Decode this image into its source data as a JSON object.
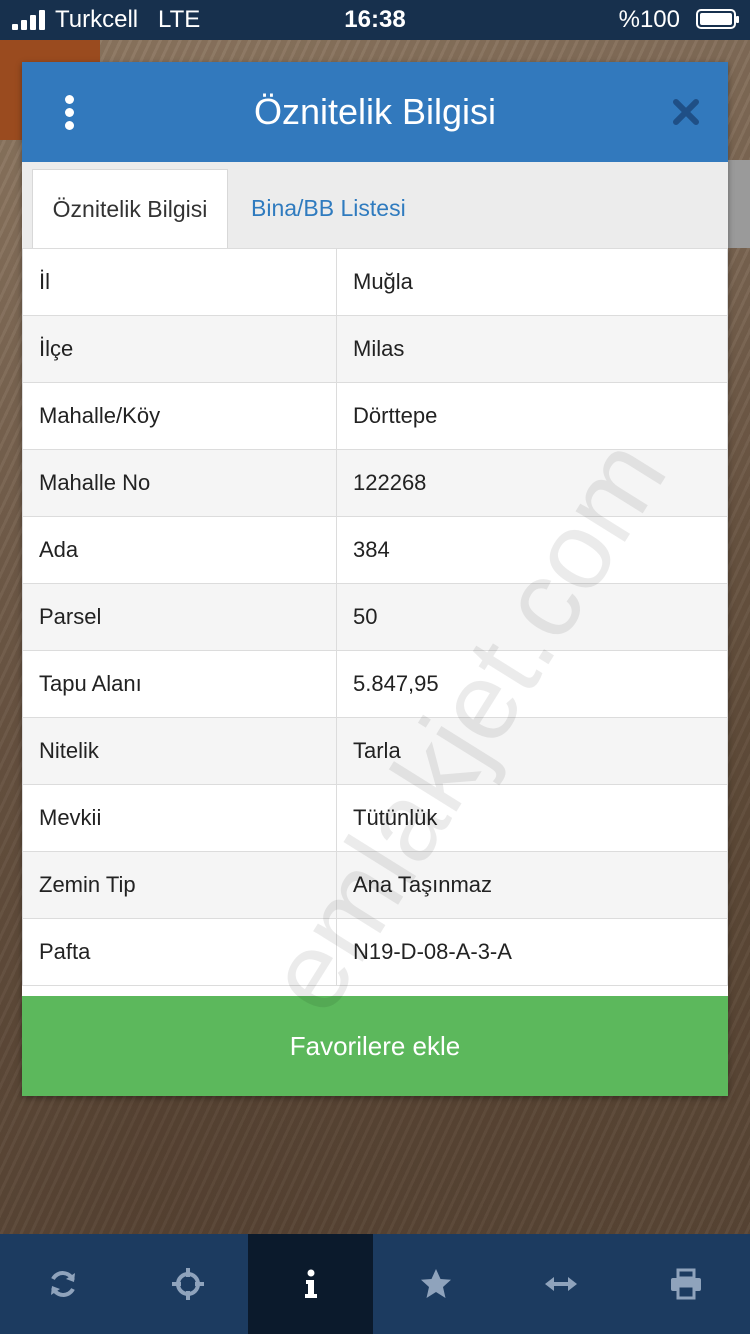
{
  "status_bar": {
    "carrier": "Turkcell",
    "network": "LTE",
    "time": "16:38",
    "battery": "%100"
  },
  "modal": {
    "title": "Öznitelik Bilgisi",
    "menu_icon": "vertical-dots-icon",
    "close_icon": "close-icon",
    "tabs": [
      {
        "label": "Öznitelik Bilgisi",
        "active": true
      },
      {
        "label": "Bina/BB Listesi",
        "active": false
      }
    ],
    "rows": [
      {
        "key": "İl",
        "value": "Muğla"
      },
      {
        "key": "İlçe",
        "value": "Milas"
      },
      {
        "key": "Mahalle/Köy",
        "value": "Dörttepe"
      },
      {
        "key": "Mahalle No",
        "value": "122268"
      },
      {
        "key": "Ada",
        "value": "384"
      },
      {
        "key": "Parsel",
        "value": "50"
      },
      {
        "key": "Tapu Alanı",
        "value": "5.847,95"
      },
      {
        "key": "Nitelik",
        "value": "Tarla"
      },
      {
        "key": "Mevkii",
        "value": "Tütünlük"
      },
      {
        "key": "Zemin Tip",
        "value": "Ana Taşınmaz"
      },
      {
        "key": "Pafta",
        "value": "N19-D-08-A-3-A"
      }
    ],
    "favorite_button": "Favorilere ekle"
  },
  "watermark": "emlakjet.com",
  "toolbar": {
    "items": [
      {
        "icon": "refresh-icon",
        "active": false
      },
      {
        "icon": "crosshair-icon",
        "active": false
      },
      {
        "icon": "info-icon",
        "active": true
      },
      {
        "icon": "star-icon",
        "active": false
      },
      {
        "icon": "measure-icon",
        "active": false
      },
      {
        "icon": "print-icon",
        "active": false
      }
    ]
  },
  "colors": {
    "header": "#3279bd",
    "button": "#5cb85c",
    "toolbar": "#1c3b60",
    "status_bar": "#17304d"
  }
}
